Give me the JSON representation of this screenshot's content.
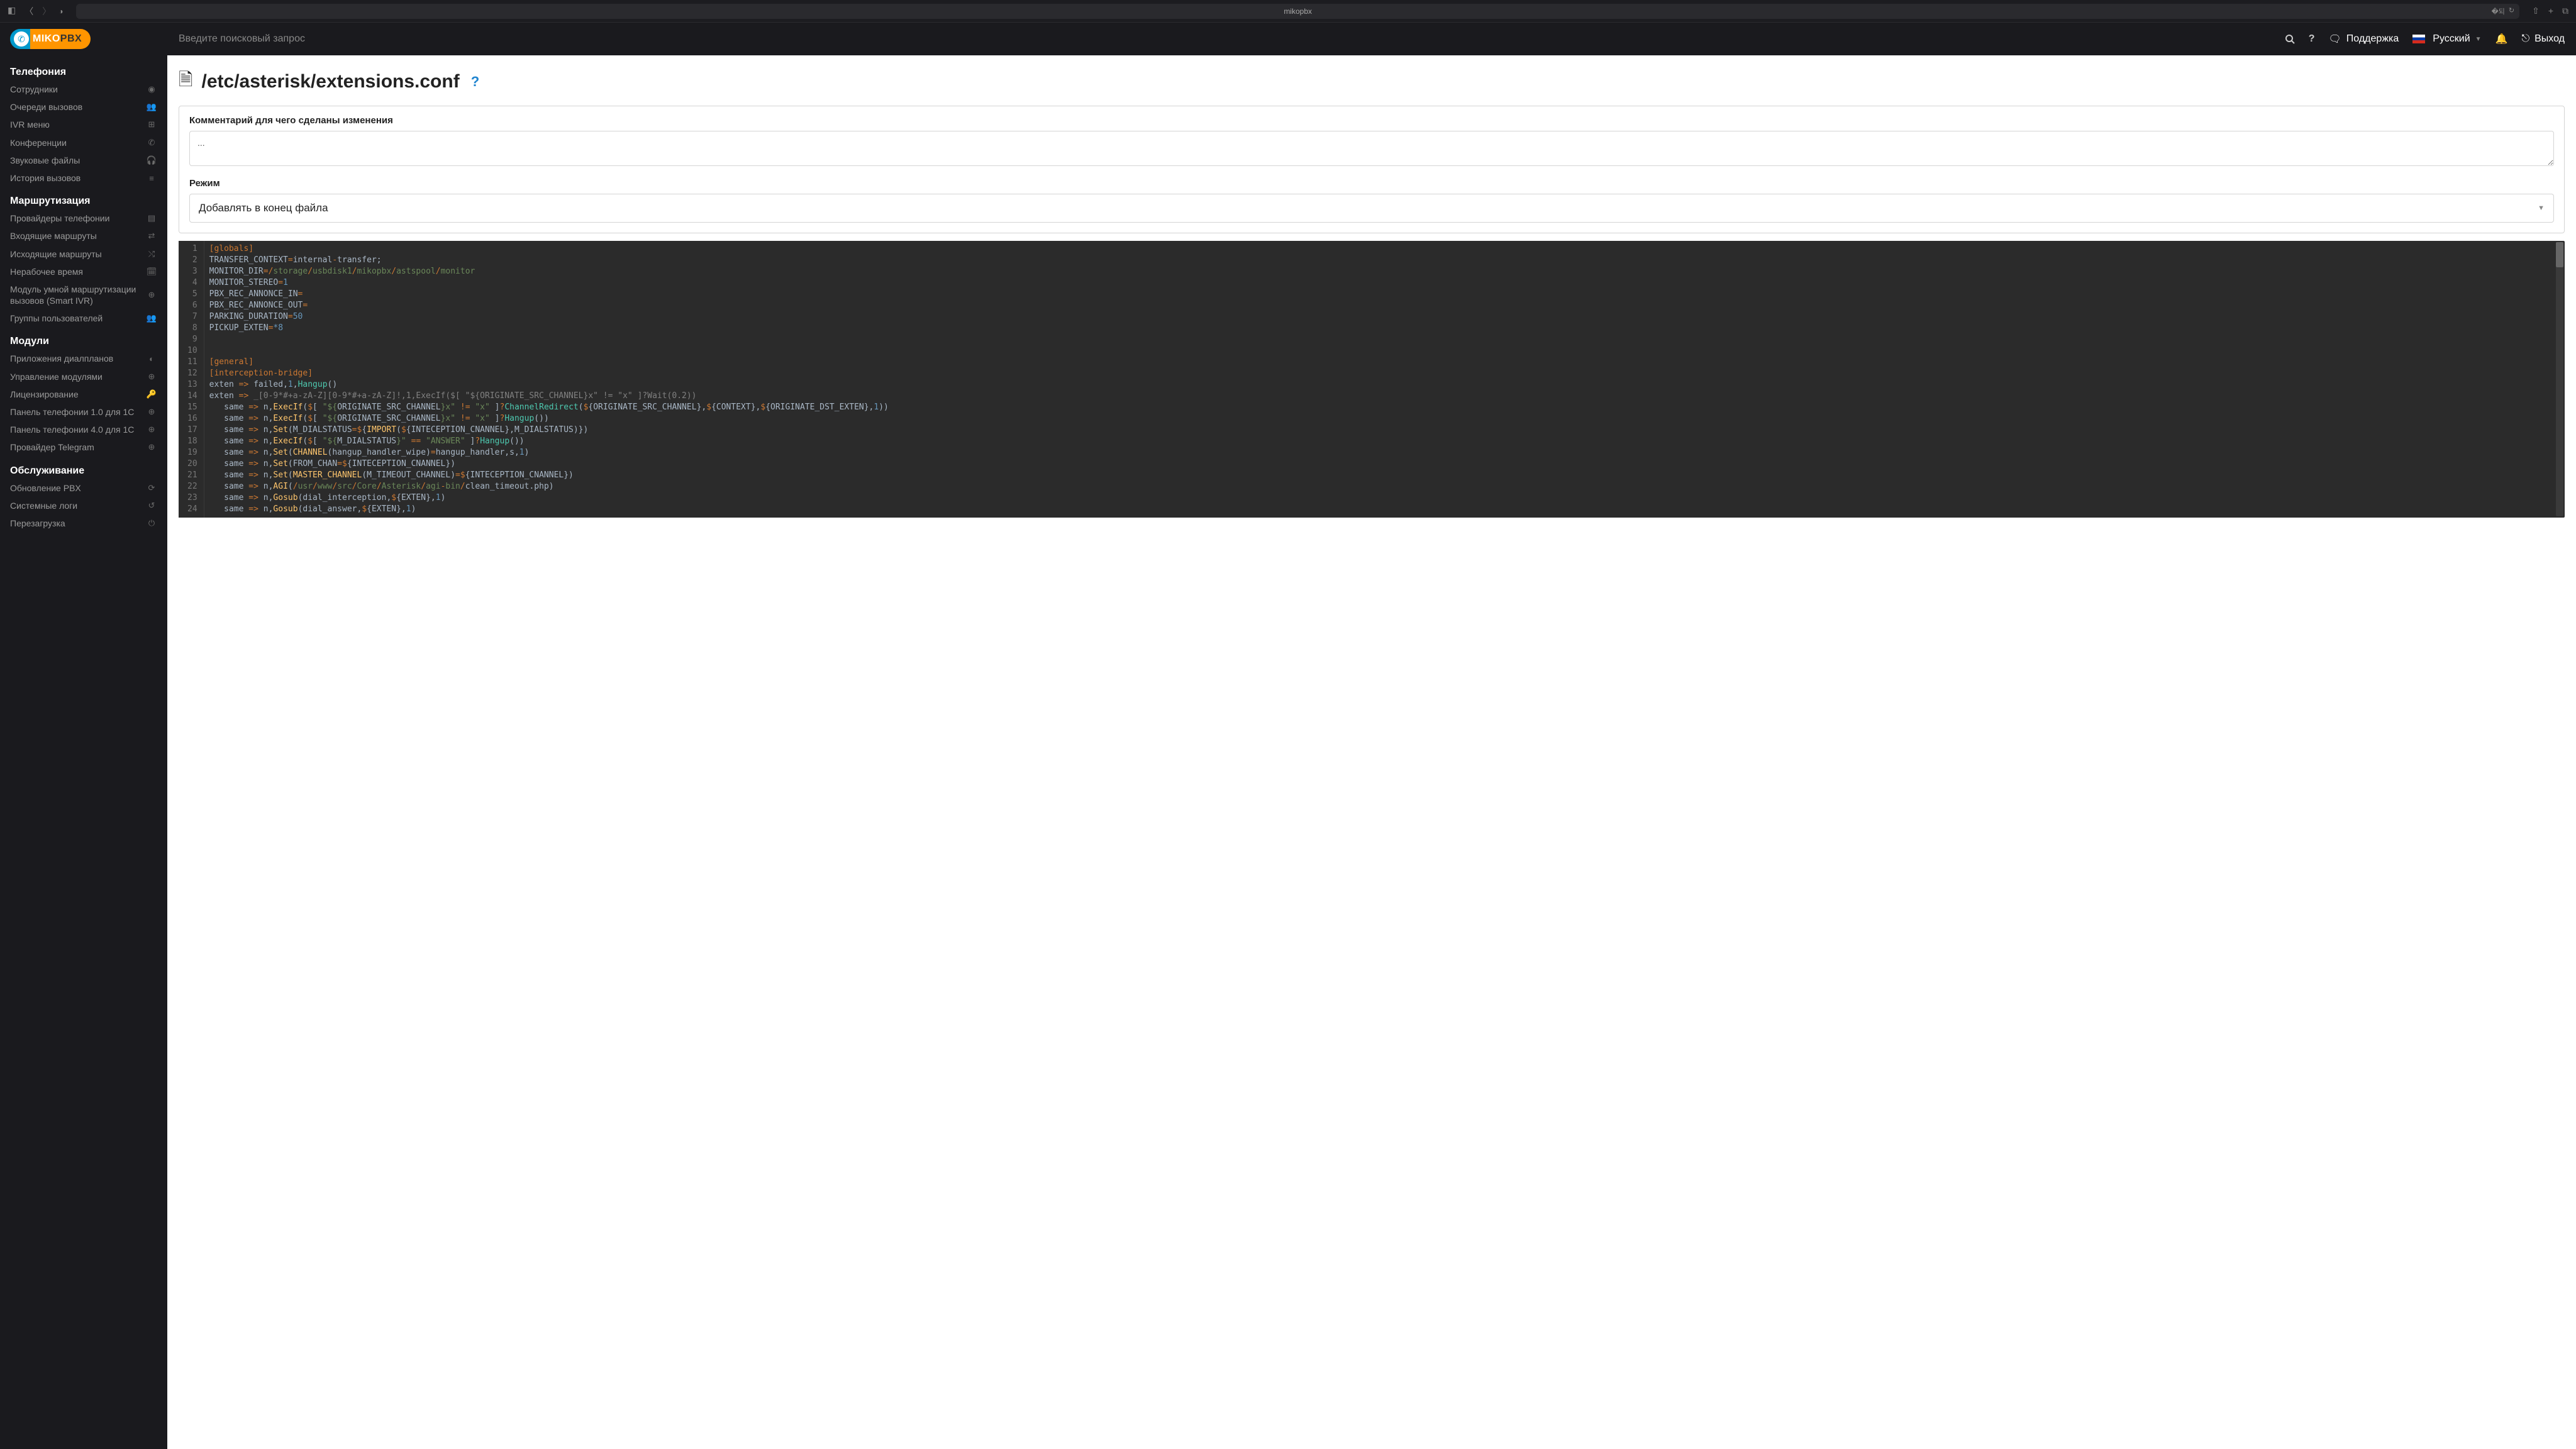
{
  "browser": {
    "url": "mikopbx"
  },
  "logo": {
    "part1": "MIKO",
    "part2": "PBX"
  },
  "sidebar": {
    "sections": [
      {
        "title": "Телефония",
        "items": [
          {
            "label": "Сотрудники",
            "icon": "user-icon"
          },
          {
            "label": "Очереди вызовов",
            "icon": "users-icon"
          },
          {
            "label": "IVR меню",
            "icon": "sitemap-icon"
          },
          {
            "label": "Конференции",
            "icon": "phone-volume-icon"
          },
          {
            "label": "Звуковые файлы",
            "icon": "headphones-icon"
          },
          {
            "label": "История вызовов",
            "icon": "list-icon"
          }
        ]
      },
      {
        "title": "Маршрутизация",
        "items": [
          {
            "label": "Провайдеры телефонии",
            "icon": "server-icon"
          },
          {
            "label": "Входящие маршруты",
            "icon": "sliders-icon"
          },
          {
            "label": "Исходящие маршруты",
            "icon": "random-icon"
          },
          {
            "label": "Нерабочее время",
            "icon": "calendar-icon"
          },
          {
            "label": "Модуль умной маршрутизации вызовов (Smart IVR)",
            "icon": "puzzle-icon"
          },
          {
            "label": "Группы пользователей",
            "icon": "users-cog-icon"
          }
        ]
      },
      {
        "title": "Модули",
        "items": [
          {
            "label": "Приложения диалпланов",
            "icon": "php-icon"
          },
          {
            "label": "Управление модулями",
            "icon": "puzzle-icon"
          },
          {
            "label": "Лицензирование",
            "icon": "key-icon"
          },
          {
            "label": "Панель телефонии 1.0 для 1С",
            "icon": "puzzle-icon"
          },
          {
            "label": "Панель телефонии 4.0 для 1С",
            "icon": "puzzle-icon"
          },
          {
            "label": "Провайдер Telegram",
            "icon": "puzzle-icon"
          }
        ]
      },
      {
        "title": "Обслуживание",
        "items": [
          {
            "label": "Обновление PBX",
            "icon": "sync-icon"
          },
          {
            "label": "Системные логи",
            "icon": "undo-icon"
          },
          {
            "label": "Перезагрузка",
            "icon": "power-icon"
          }
        ]
      }
    ]
  },
  "topbar": {
    "search_placeholder": "Введите поисковый запрос",
    "support": "Поддержка",
    "language": "Русский",
    "logout": "Выход"
  },
  "page": {
    "title": "/etc/asterisk/extensions.conf",
    "comment_label": "Комментарий для чего сделаны изменения",
    "comment_value": "...",
    "mode_label": "Режим",
    "mode_value": "Добавлять в конец файла"
  },
  "code": {
    "total_lines": 24,
    "lines": [
      [
        [
          "[globals]",
          "tk-sec"
        ]
      ],
      [
        [
          "TRANSFER_CONTEXT",
          "tk-id"
        ],
        [
          "=",
          "tk-op"
        ],
        [
          "internal",
          "tk-id"
        ],
        [
          "-",
          "tk-op"
        ],
        [
          "transfer;",
          "tk-id"
        ]
      ],
      [
        [
          "MONITOR_DIR",
          "tk-id"
        ],
        [
          "=/",
          "tk-op"
        ],
        [
          "storage",
          "tk-path"
        ],
        [
          "/",
          "tk-op"
        ],
        [
          "usbdisk1",
          "tk-path"
        ],
        [
          "/",
          "tk-op"
        ],
        [
          "mikopbx",
          "tk-path"
        ],
        [
          "/",
          "tk-op"
        ],
        [
          "astspool",
          "tk-path"
        ],
        [
          "/",
          "tk-op"
        ],
        [
          "monitor",
          "tk-path"
        ]
      ],
      [
        [
          "MONITOR_STEREO",
          "tk-id"
        ],
        [
          "=",
          "tk-op"
        ],
        [
          "1",
          "tk-num"
        ]
      ],
      [
        [
          "PBX_REC_ANNONCE_IN",
          "tk-id"
        ],
        [
          "=",
          "tk-op"
        ]
      ],
      [
        [
          "PBX_REC_ANNONCE_OUT",
          "tk-id"
        ],
        [
          "=",
          "tk-op"
        ]
      ],
      [
        [
          "PARKING_DURATION",
          "tk-id"
        ],
        [
          "=",
          "tk-op"
        ],
        [
          "50",
          "tk-num"
        ]
      ],
      [
        [
          "PICKUP_EXTEN",
          "tk-id"
        ],
        [
          "=",
          "tk-op"
        ],
        [
          "*8",
          "tk-num"
        ]
      ],
      [],
      [],
      [
        [
          "[general]",
          "tk-sec"
        ]
      ],
      [
        [
          "[interception",
          "tk-sec"
        ],
        [
          "-",
          "tk-op"
        ],
        [
          "bridge]",
          "tk-sec"
        ]
      ],
      [
        [
          "exten ",
          "tk-id"
        ],
        [
          "=> ",
          "tk-op"
        ],
        [
          "failed",
          "tk-id"
        ],
        [
          ",",
          "tk-id"
        ],
        [
          "1",
          "tk-num"
        ],
        [
          ",",
          "tk-id"
        ],
        [
          "Hangup",
          "tk-cyan"
        ],
        [
          "()",
          "tk-id"
        ]
      ],
      [
        [
          "exten ",
          "tk-id"
        ],
        [
          "=> ",
          "tk-op"
        ],
        [
          "_[0-9*#+a-zA-Z][0-9*#+a-zA-Z]!,1,ExecIf($[ \"${ORIGINATE_SRC_CHANNEL}x\" != \"x\" ]?Wait(0.2))",
          "tk-cmt"
        ]
      ],
      [
        [
          "   same ",
          "tk-id"
        ],
        [
          "=> ",
          "tk-op"
        ],
        [
          "n,",
          "tk-id"
        ],
        [
          "ExecIf",
          "tk-fn"
        ],
        [
          "(",
          "tk-id"
        ],
        [
          "$",
          "tk-op"
        ],
        [
          "[ ",
          "tk-id"
        ],
        [
          "\"${",
          "tk-str"
        ],
        [
          "ORIGINATE_SRC_CHANNEL",
          "tk-id"
        ],
        [
          "}x\" ",
          "tk-str"
        ],
        [
          "!= ",
          "tk-op"
        ],
        [
          "\"x\" ",
          "tk-str"
        ],
        [
          "]",
          "tk-id"
        ],
        [
          "?",
          "tk-op"
        ],
        [
          "ChannelRedirect",
          "tk-cyan"
        ],
        [
          "(",
          "tk-id"
        ],
        [
          "$",
          "tk-op"
        ],
        [
          "{",
          "tk-id"
        ],
        [
          "ORIGINATE_SRC_CHANNEL",
          "tk-id"
        ],
        [
          "},",
          "tk-id"
        ],
        [
          "$",
          "tk-op"
        ],
        [
          "{",
          "tk-id"
        ],
        [
          "CONTEXT",
          "tk-id"
        ],
        [
          "},",
          "tk-id"
        ],
        [
          "$",
          "tk-op"
        ],
        [
          "{",
          "tk-id"
        ],
        [
          "ORIGINATE_DST_EXTEN",
          "tk-id"
        ],
        [
          "},",
          "tk-id"
        ],
        [
          "1",
          "tk-num"
        ],
        [
          "))",
          "tk-id"
        ]
      ],
      [
        [
          "   same ",
          "tk-id"
        ],
        [
          "=> ",
          "tk-op"
        ],
        [
          "n,",
          "tk-id"
        ],
        [
          "ExecIf",
          "tk-fn"
        ],
        [
          "(",
          "tk-id"
        ],
        [
          "$",
          "tk-op"
        ],
        [
          "[ ",
          "tk-id"
        ],
        [
          "\"${",
          "tk-str"
        ],
        [
          "ORIGINATE_SRC_CHANNEL",
          "tk-id"
        ],
        [
          "}x\" ",
          "tk-str"
        ],
        [
          "!= ",
          "tk-op"
        ],
        [
          "\"x\" ",
          "tk-str"
        ],
        [
          "]",
          "tk-id"
        ],
        [
          "?",
          "tk-op"
        ],
        [
          "Hangup",
          "tk-cyan"
        ],
        [
          "())",
          "tk-id"
        ]
      ],
      [
        [
          "   same ",
          "tk-id"
        ],
        [
          "=> ",
          "tk-op"
        ],
        [
          "n,",
          "tk-id"
        ],
        [
          "Set",
          "tk-fn"
        ],
        [
          "(M_DIALSTATUS",
          "tk-id"
        ],
        [
          "=",
          "tk-op"
        ],
        [
          "$",
          "tk-op"
        ],
        [
          "{",
          "tk-id"
        ],
        [
          "IMPORT",
          "tk-fn"
        ],
        [
          "(",
          "tk-id"
        ],
        [
          "$",
          "tk-op"
        ],
        [
          "{",
          "tk-id"
        ],
        [
          "INTECEPTION_CNANNEL",
          "tk-id"
        ],
        [
          "},M_DIALSTATUS)})",
          "tk-id"
        ]
      ],
      [
        [
          "   same ",
          "tk-id"
        ],
        [
          "=> ",
          "tk-op"
        ],
        [
          "n,",
          "tk-id"
        ],
        [
          "ExecIf",
          "tk-fn"
        ],
        [
          "(",
          "tk-id"
        ],
        [
          "$",
          "tk-op"
        ],
        [
          "[ ",
          "tk-id"
        ],
        [
          "\"${",
          "tk-str"
        ],
        [
          "M_DIALSTATUS",
          "tk-id"
        ],
        [
          "}\" ",
          "tk-str"
        ],
        [
          "== ",
          "tk-op"
        ],
        [
          "\"ANSWER\" ",
          "tk-str"
        ],
        [
          "]",
          "tk-id"
        ],
        [
          "?",
          "tk-op"
        ],
        [
          "Hangup",
          "tk-cyan"
        ],
        [
          "())",
          "tk-id"
        ]
      ],
      [
        [
          "   same ",
          "tk-id"
        ],
        [
          "=> ",
          "tk-op"
        ],
        [
          "n,",
          "tk-id"
        ],
        [
          "Set",
          "tk-fn"
        ],
        [
          "(",
          "tk-id"
        ],
        [
          "CHANNEL",
          "tk-fn"
        ],
        [
          "(hangup_handler_wipe)",
          "tk-id"
        ],
        [
          "=",
          "tk-op"
        ],
        [
          "hangup_handler,s,",
          "tk-id"
        ],
        [
          "1",
          "tk-num"
        ],
        [
          ")",
          "tk-id"
        ]
      ],
      [
        [
          "   same ",
          "tk-id"
        ],
        [
          "=> ",
          "tk-op"
        ],
        [
          "n,",
          "tk-id"
        ],
        [
          "Set",
          "tk-fn"
        ],
        [
          "(FROM_CHAN",
          "tk-id"
        ],
        [
          "=",
          "tk-op"
        ],
        [
          "$",
          "tk-op"
        ],
        [
          "{",
          "tk-id"
        ],
        [
          "INTECEPTION_CNANNEL",
          "tk-id"
        ],
        [
          "})",
          "tk-id"
        ]
      ],
      [
        [
          "   same ",
          "tk-id"
        ],
        [
          "=> ",
          "tk-op"
        ],
        [
          "n,",
          "tk-id"
        ],
        [
          "Set",
          "tk-fn"
        ],
        [
          "(",
          "tk-id"
        ],
        [
          "MASTER_CHANNEL",
          "tk-fn"
        ],
        [
          "(M_TIMEOUT_CHANNEL)",
          "tk-id"
        ],
        [
          "=",
          "tk-op"
        ],
        [
          "$",
          "tk-op"
        ],
        [
          "{",
          "tk-id"
        ],
        [
          "INTECEPTION_CNANNEL",
          "tk-id"
        ],
        [
          "})",
          "tk-id"
        ]
      ],
      [
        [
          "   same ",
          "tk-id"
        ],
        [
          "=> ",
          "tk-op"
        ],
        [
          "n,",
          "tk-id"
        ],
        [
          "AGI",
          "tk-fn"
        ],
        [
          "(",
          "tk-id"
        ],
        [
          "/",
          "tk-op"
        ],
        [
          "usr",
          "tk-path"
        ],
        [
          "/",
          "tk-op"
        ],
        [
          "www",
          "tk-path"
        ],
        [
          "/",
          "tk-op"
        ],
        [
          "src",
          "tk-path"
        ],
        [
          "/",
          "tk-op"
        ],
        [
          "Core",
          "tk-path"
        ],
        [
          "/",
          "tk-op"
        ],
        [
          "Asterisk",
          "tk-path"
        ],
        [
          "/",
          "tk-op"
        ],
        [
          "agi",
          "tk-path"
        ],
        [
          "-",
          "tk-op"
        ],
        [
          "bin",
          "tk-path"
        ],
        [
          "/",
          "tk-op"
        ],
        [
          "clean_timeout.php)",
          "tk-id"
        ]
      ],
      [
        [
          "   same ",
          "tk-id"
        ],
        [
          "=> ",
          "tk-op"
        ],
        [
          "n,",
          "tk-id"
        ],
        [
          "Gosub",
          "tk-fn"
        ],
        [
          "(dial_interception,",
          "tk-id"
        ],
        [
          "$",
          "tk-op"
        ],
        [
          "{",
          "tk-id"
        ],
        [
          "EXTEN",
          "tk-id"
        ],
        [
          "},",
          "tk-id"
        ],
        [
          "1",
          "tk-num"
        ],
        [
          ")",
          "tk-id"
        ]
      ],
      [
        [
          "   same ",
          "tk-id"
        ],
        [
          "=> ",
          "tk-op"
        ],
        [
          "n,",
          "tk-id"
        ],
        [
          "Gosub",
          "tk-fn"
        ],
        [
          "(dial_answer,",
          "tk-id"
        ],
        [
          "$",
          "tk-op"
        ],
        [
          "{",
          "tk-id"
        ],
        [
          "EXTEN",
          "tk-id"
        ],
        [
          "},",
          "tk-id"
        ],
        [
          "1",
          "tk-num"
        ],
        [
          ")",
          "tk-id"
        ]
      ]
    ]
  }
}
